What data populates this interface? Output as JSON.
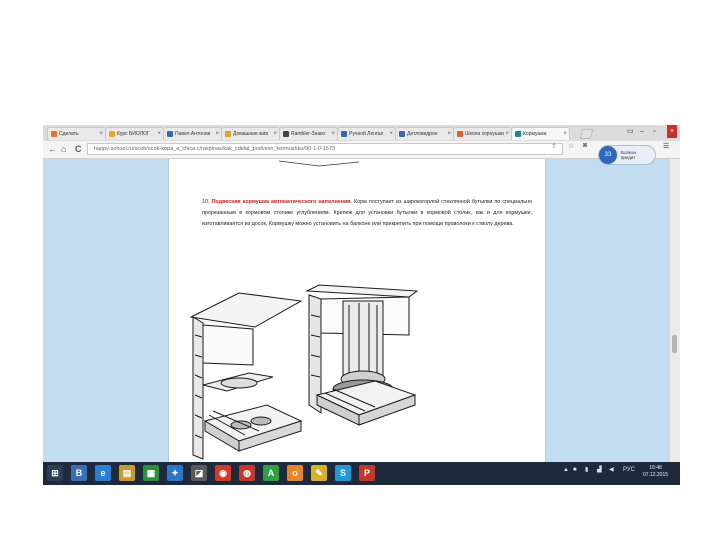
{
  "browser": {
    "tabs": [
      {
        "label": "Сделать",
        "favicon_color": "#e8742a",
        "active": false
      },
      {
        "label": "Курс БИОЛОГ",
        "favicon_color": "#f0a526",
        "active": false
      },
      {
        "label": "Павел Антонов",
        "favicon_color": "#3a66b4",
        "active": false
      },
      {
        "label": "Домашние жив",
        "favicon_color": "#d9a62b",
        "active": false
      },
      {
        "label": "Rambler-Знако",
        "favicon_color": "#444444",
        "active": false
      },
      {
        "label": "Ручной Ленгал",
        "favicon_color": "#3a66b4",
        "active": false
      },
      {
        "label": "Дятловедрон",
        "favicon_color": "#3a66b4",
        "active": false
      },
      {
        "label": "Школа хорнушки",
        "favicon_color": "#e06030",
        "active": false
      },
      {
        "label": "Кормушка",
        "favicon_color": "#1a8a8a",
        "active": true
      }
    ],
    "window_controls": [
      "–",
      "▫",
      "×"
    ],
    "address": "happy-school.ru/scob/ocok-kopa_a_chica.c/raspinas/kak_cdelat_podvesn_kormushku/90-1-0-1573",
    "nav": {
      "back": "←",
      "forward": "→",
      "reload": "C",
      "home": "⌂"
    }
  },
  "page": {
    "paragraph_number": "10.",
    "paragraph_highlight": "Подвесная кормушка автоматического наполнения.",
    "paragraph_text": "Корм поступает из широкогорлой стеклянной бутылки по специально прорезанным в кормовом столике углублениям. Крепеж для установки бутылки в кормовой столик, как и для кормушки, изготавливается из досок. Кормушку можно установить на балконе или прикрепить при помощи проволоки к стволу дерева."
  },
  "widget": {
    "badge": "33",
    "lines": [
      "Болезн",
      "вредит"
    ]
  },
  "taskbar": {
    "apps": [
      {
        "label": "⊞",
        "color": "#2c3e56"
      },
      {
        "label": "B",
        "color": "#3b6fb3"
      },
      {
        "label": "e",
        "color": "#2a7fd4"
      },
      {
        "label": "▤",
        "color": "#c99a2e"
      },
      {
        "label": "▦",
        "color": "#2f8f3a"
      },
      {
        "label": "✦",
        "color": "#2e76c8"
      },
      {
        "label": "◪",
        "color": "#5a5a5a"
      },
      {
        "label": "◉",
        "color": "#d23a2a"
      },
      {
        "label": "◍",
        "color": "#c0392b"
      },
      {
        "label": "A",
        "color": "#2f9e45"
      },
      {
        "label": "o",
        "color": "#e8842a"
      },
      {
        "label": "✎",
        "color": "#d8b02a"
      },
      {
        "label": "S",
        "color": "#1f9ad6"
      },
      {
        "label": "P",
        "color": "#c0392b"
      }
    ],
    "language": "РУС",
    "time": "18:48",
    "date": "07.12.2015"
  }
}
